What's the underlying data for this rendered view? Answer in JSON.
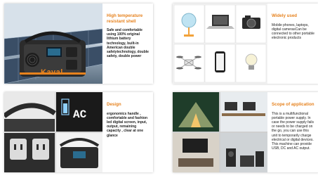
{
  "panels": [
    {
      "title": "High temperature resistant shell",
      "body": "Safe and comfortable using 100% original lithium battery technology, built-in American double safetytechnology, double safety, double power",
      "brand": "Kaval"
    },
    {
      "title": "Widely used",
      "body": "Mobile phones, laptops, digital camerasCan be connected to other portable electronic products",
      "devices": [
        "fan",
        "laptop",
        "camera",
        "drone",
        "phone",
        "bulb"
      ]
    },
    {
      "title": "Design",
      "body": "ergonomics handle , comfortable and fashion led digital screen,  input, output, remaining capacity , clear at one glance",
      "display": "AC"
    },
    {
      "title": "Scope of application",
      "body": "This is a multifunctional portable power supply. In case the power supply fails or needs to be charged on the go, you can use this unit to temporarily charge electrical or digital devices. This machine can provide USB, DC and AC output."
    }
  ],
  "colors": {
    "accent": "#e6821e",
    "text": "#222222"
  }
}
